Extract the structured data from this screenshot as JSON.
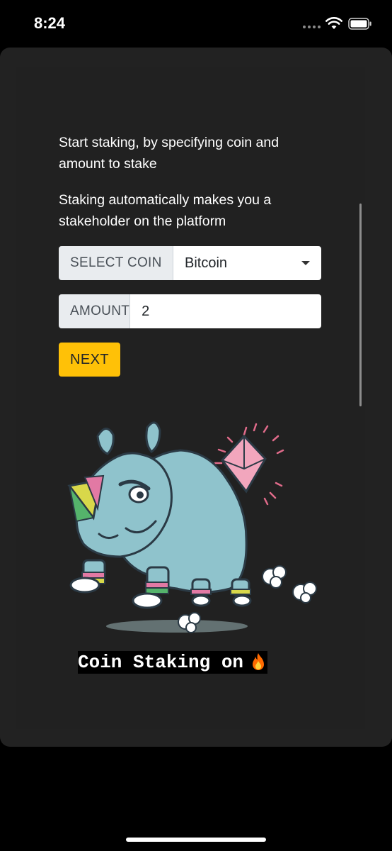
{
  "status_bar": {
    "time": "8:24",
    "icons": [
      "signal-dots-icon",
      "wifi-icon",
      "battery-icon"
    ]
  },
  "intro": {
    "line1": "Start staking, by specifying coin and amount to stake",
    "line2": "Staking automatically makes you a stakeholder on the platform"
  },
  "form": {
    "coin_label": "SELECT COIN",
    "coin_value": "Bitcoin",
    "amount_label": "AMOUNT",
    "amount_value": "2",
    "next_label": "NEXT"
  },
  "caption": {
    "text": "Coin Staking on",
    "icon": "fire-icon"
  },
  "colors": {
    "sheet_background": "#222222",
    "button_accent": "#ffc107",
    "input_addon": "#e9ecef",
    "mascot_body": "#8fc3cc"
  }
}
